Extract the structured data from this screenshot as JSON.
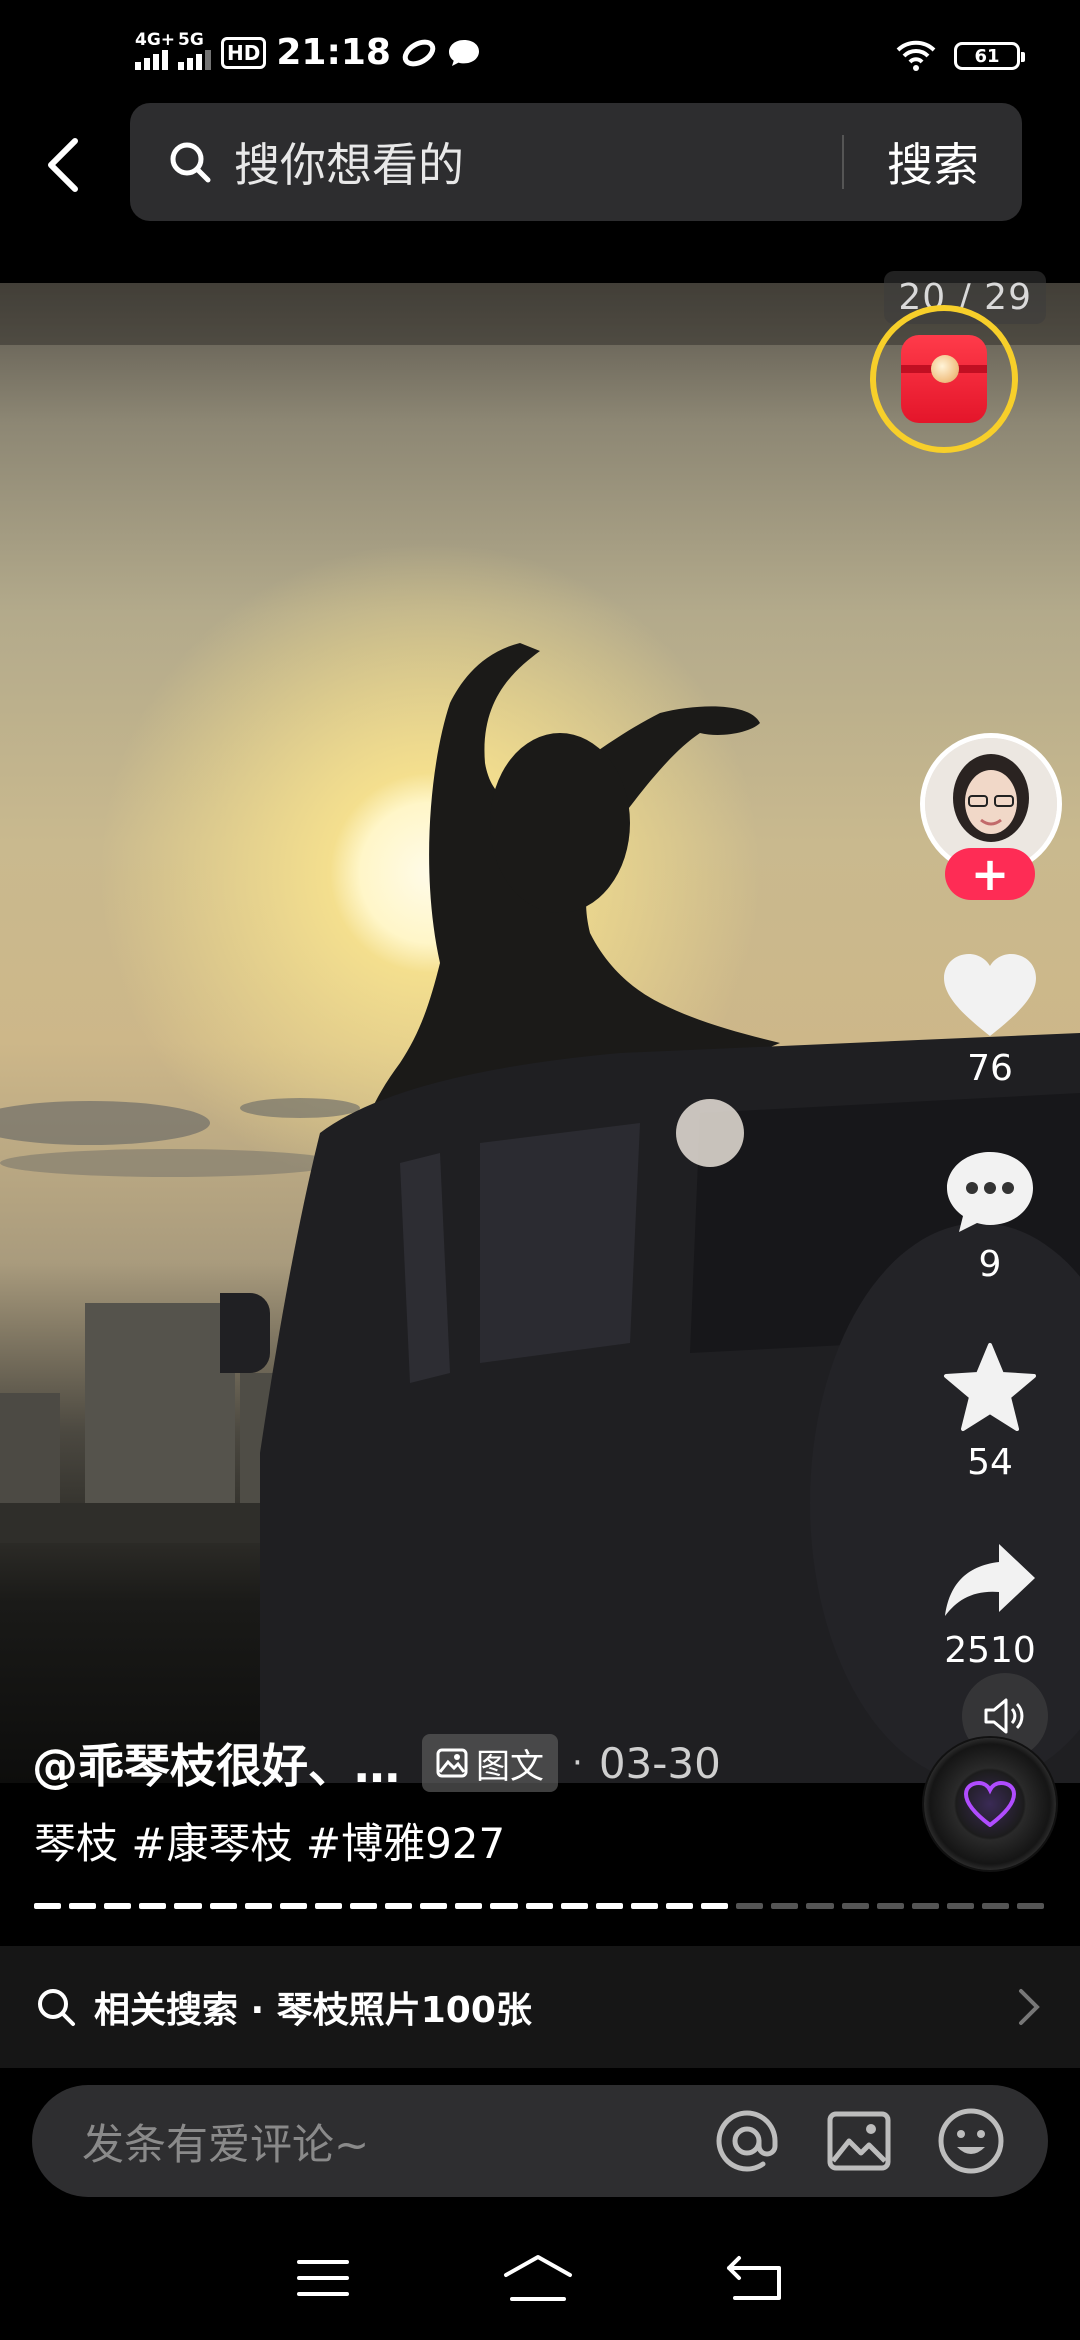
{
  "status_bar": {
    "network_1": "4G+",
    "network_2": "5G",
    "hd": "HD",
    "time": "21:18",
    "battery": "61"
  },
  "header": {
    "search_placeholder": "搜你想看的",
    "search_button": "搜索"
  },
  "media": {
    "counter": "20 / 29"
  },
  "actions": {
    "likes": "76",
    "comments": "9",
    "favorites": "54",
    "shares": "2510"
  },
  "post": {
    "author": "@乖琴枝很好、…",
    "badge": "图文",
    "date": "03-30",
    "description": "琴枝 #康琴枝 #博雅927",
    "progress_current": 20,
    "progress_total": 29
  },
  "related": {
    "label": "相关搜索 · 琴枝照片100张"
  },
  "comment": {
    "placeholder": "发条有爱评论~"
  },
  "colors": {
    "accent": "#fe2c55",
    "redpacket_ring": "#f7cf2a"
  }
}
